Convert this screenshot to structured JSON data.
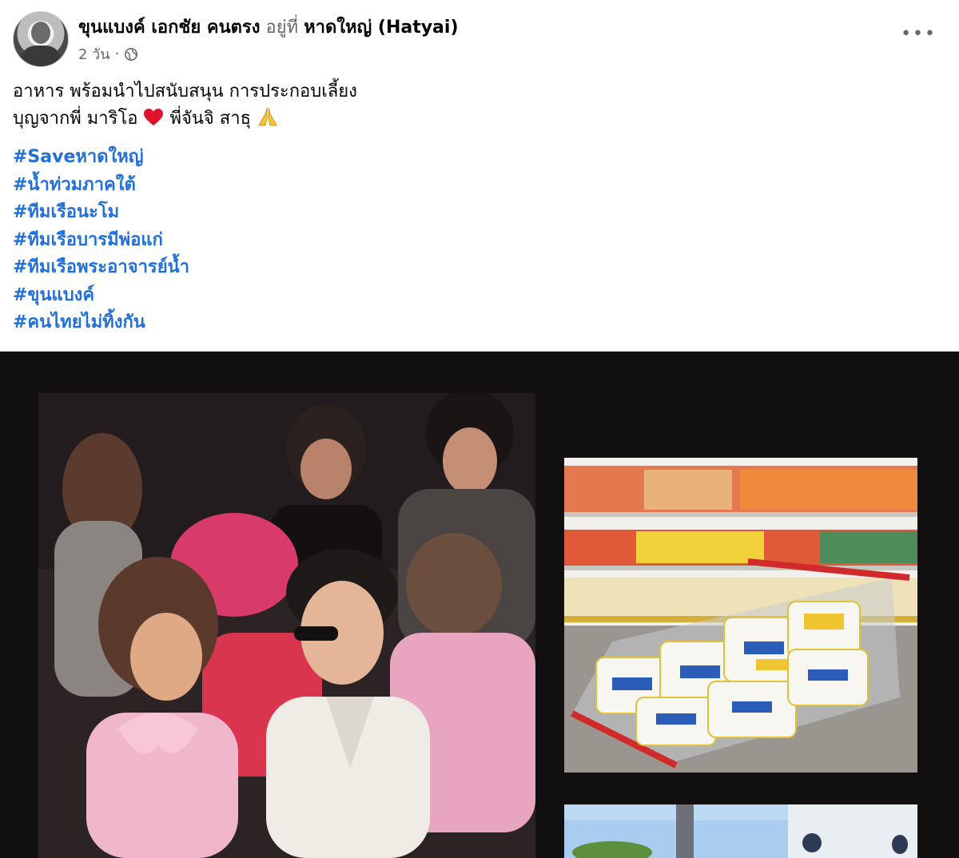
{
  "post": {
    "author": "ขุนแบงค์ เอกชัย คนตรง",
    "at_label": "อยู่ที่",
    "location": "หาดใหญ่ (Hatyai)",
    "time": "2 วัน",
    "separator": "·",
    "more_label": "•••",
    "text_line1": "อาหาร พร้อมนำไปสนับสนุน การประกอบเลี้ยง",
    "text_line2_a": "บุญจากพี่ มาริโอ",
    "text_line2_b": "พี่จันจิ สาธุ",
    "hashtags": [
      "#Saveหาดใหญ่",
      "#น้ำท่วมภาคใต้",
      "#ทีมเรือนะโม",
      "#ทีมเรือบารมีพ่อแก่",
      "#ทีมเรือพระอาจารย์น้ำ",
      "#ขุนแบงค์",
      "#คนไทยไม่ทิ้งกัน"
    ]
  },
  "icons": {
    "globe": "globe-icon",
    "heart": "red-heart-emoji",
    "pray": "folded-hands-emoji",
    "more": "more-options-icon"
  },
  "colors": {
    "hashtag": "#216fdb",
    "secondary_text": "#65676b",
    "media_bg": "#120f10"
  }
}
